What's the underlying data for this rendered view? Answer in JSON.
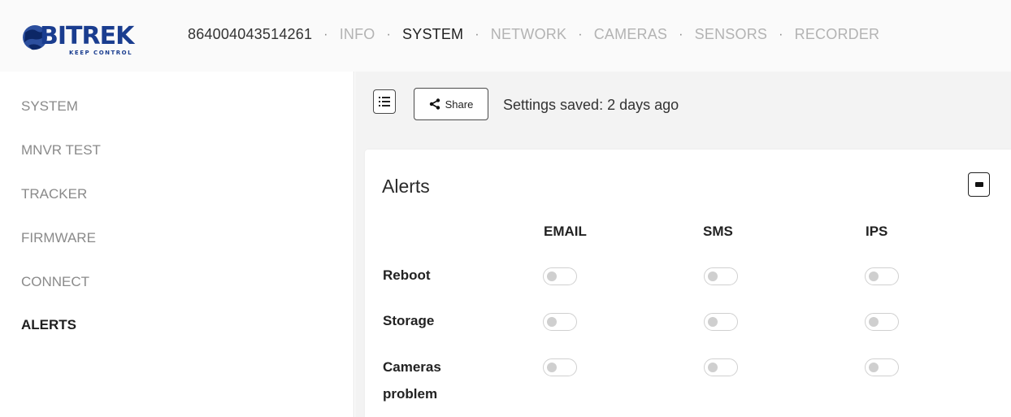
{
  "header": {
    "device_id": "864004043514261",
    "separator": "·",
    "nav": [
      {
        "label": "INFO",
        "active": false
      },
      {
        "label": "SYSTEM",
        "active": true
      },
      {
        "label": "NETWORK",
        "active": false
      },
      {
        "label": "CAMERAS",
        "active": false
      },
      {
        "label": "SENSORS",
        "active": false
      },
      {
        "label": "RECORDER",
        "active": false
      }
    ]
  },
  "sidebar": {
    "items": [
      {
        "label": "SYSTEM",
        "active": false
      },
      {
        "label": "MNVR TEST",
        "active": false
      },
      {
        "label": "TRACKER",
        "active": false
      },
      {
        "label": "FIRMWARE",
        "active": false
      },
      {
        "label": "CONNECT",
        "active": false
      },
      {
        "label": "ALERTS",
        "active": true
      }
    ]
  },
  "toolbar": {
    "share_label": "Share",
    "saved_text": "Settings saved: 2 days ago"
  },
  "alerts": {
    "title": "Alerts",
    "columns": [
      "EMAIL",
      "SMS",
      "IPS"
    ],
    "rows": [
      {
        "label": "Reboot",
        "email": false,
        "sms": false,
        "ips": false
      },
      {
        "label": "Storage",
        "email": false,
        "sms": false,
        "ips": false
      },
      {
        "label": "Cameras problem",
        "label_line1": "Cameras",
        "label_line2": "problem",
        "email": false,
        "sms": false,
        "ips": false
      }
    ]
  },
  "colors": {
    "accent": "#1a3d8f",
    "active_text": "#1f1f1f",
    "inactive_text": "#b3b3b3",
    "toggle_off": "#cfcfcf"
  }
}
